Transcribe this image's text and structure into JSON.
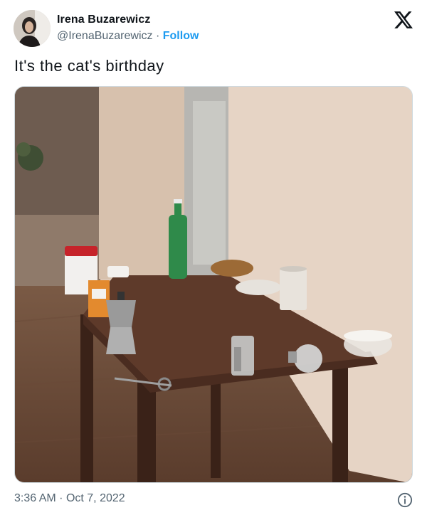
{
  "tweet": {
    "author_name": "Irena Buzarewicz",
    "handle": "@IrenaBuzarewicz",
    "separator": "·",
    "follow_label": "Follow",
    "text": "It's the cat's birthday",
    "time": "3:36 AM",
    "date": "Oct 7, 2022",
    "photo_icon": "photo-of-table-with-objects",
    "x_icon": "x-logo-icon",
    "info_icon": "info-icon"
  },
  "colors": {
    "link": "#1d9bf0",
    "muted": "#536471",
    "text": "#0f1419",
    "border": "#cfd9de"
  }
}
